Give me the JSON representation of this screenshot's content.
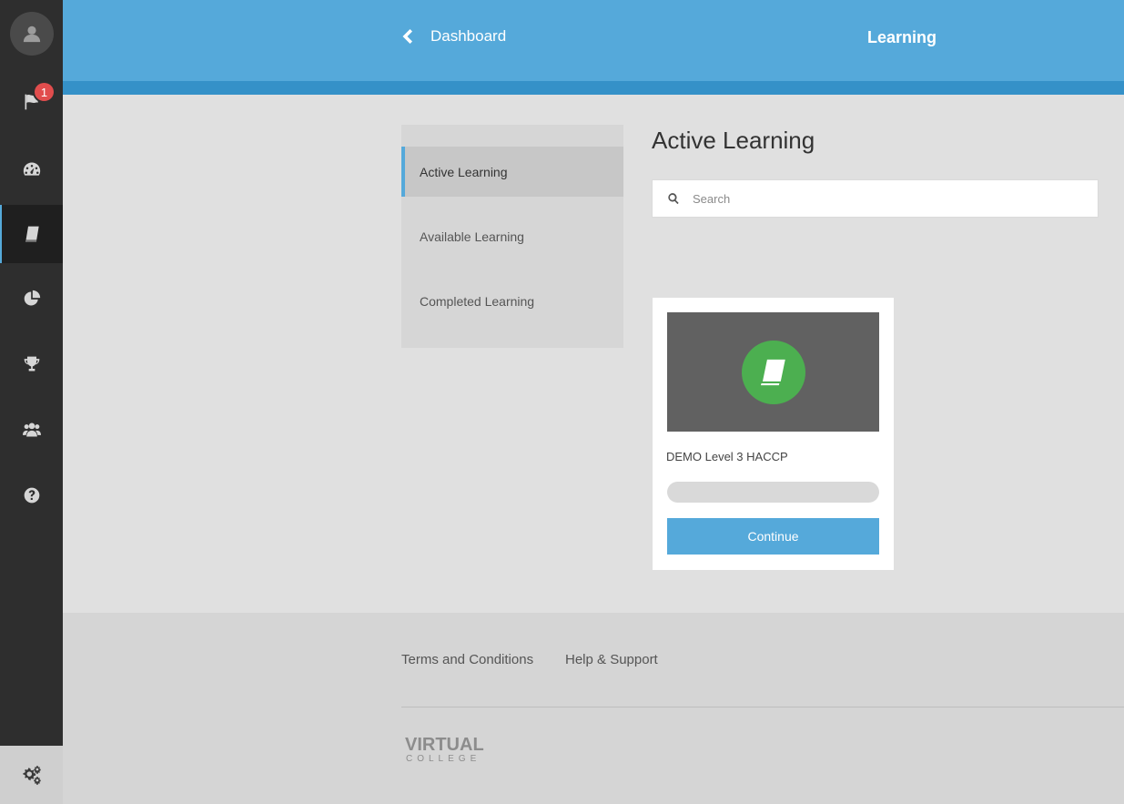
{
  "sidebar": {
    "items": [
      {
        "icon": "user-icon"
      },
      {
        "icon": "flag-icon",
        "badge": "1"
      },
      {
        "icon": "dashboard-icon"
      },
      {
        "icon": "book-icon"
      },
      {
        "icon": "pie-chart-icon"
      },
      {
        "icon": "trophy-icon"
      },
      {
        "icon": "users-icon"
      },
      {
        "icon": "help-icon"
      }
    ],
    "settings_icon": "gears-icon",
    "active_item": "book-icon"
  },
  "header": {
    "back_label": "Dashboard",
    "title": "Learning"
  },
  "subnav": {
    "items": [
      {
        "label": "Active Learning",
        "active": true
      },
      {
        "label": "Available Learning",
        "active": false
      },
      {
        "label": "Completed Learning",
        "active": false
      }
    ]
  },
  "main": {
    "title": "Active Learning",
    "search": {
      "placeholder": "Search",
      "value": ""
    }
  },
  "courses": [
    {
      "title": "DEMO Level 3 HACCP",
      "progress": 0,
      "button_label": "Continue"
    }
  ],
  "footer": {
    "links": [
      "Terms and Conditions",
      "Help & Support"
    ],
    "logo": {
      "line1": "VIRTUAL",
      "line2": "COLLEGE"
    }
  },
  "colors": {
    "accent": "#55a9da",
    "accent_dark": "#3591c8",
    "sidebar": "#2e2e2e",
    "badge": "#e14d4d",
    "course_icon": "#4caf50"
  }
}
